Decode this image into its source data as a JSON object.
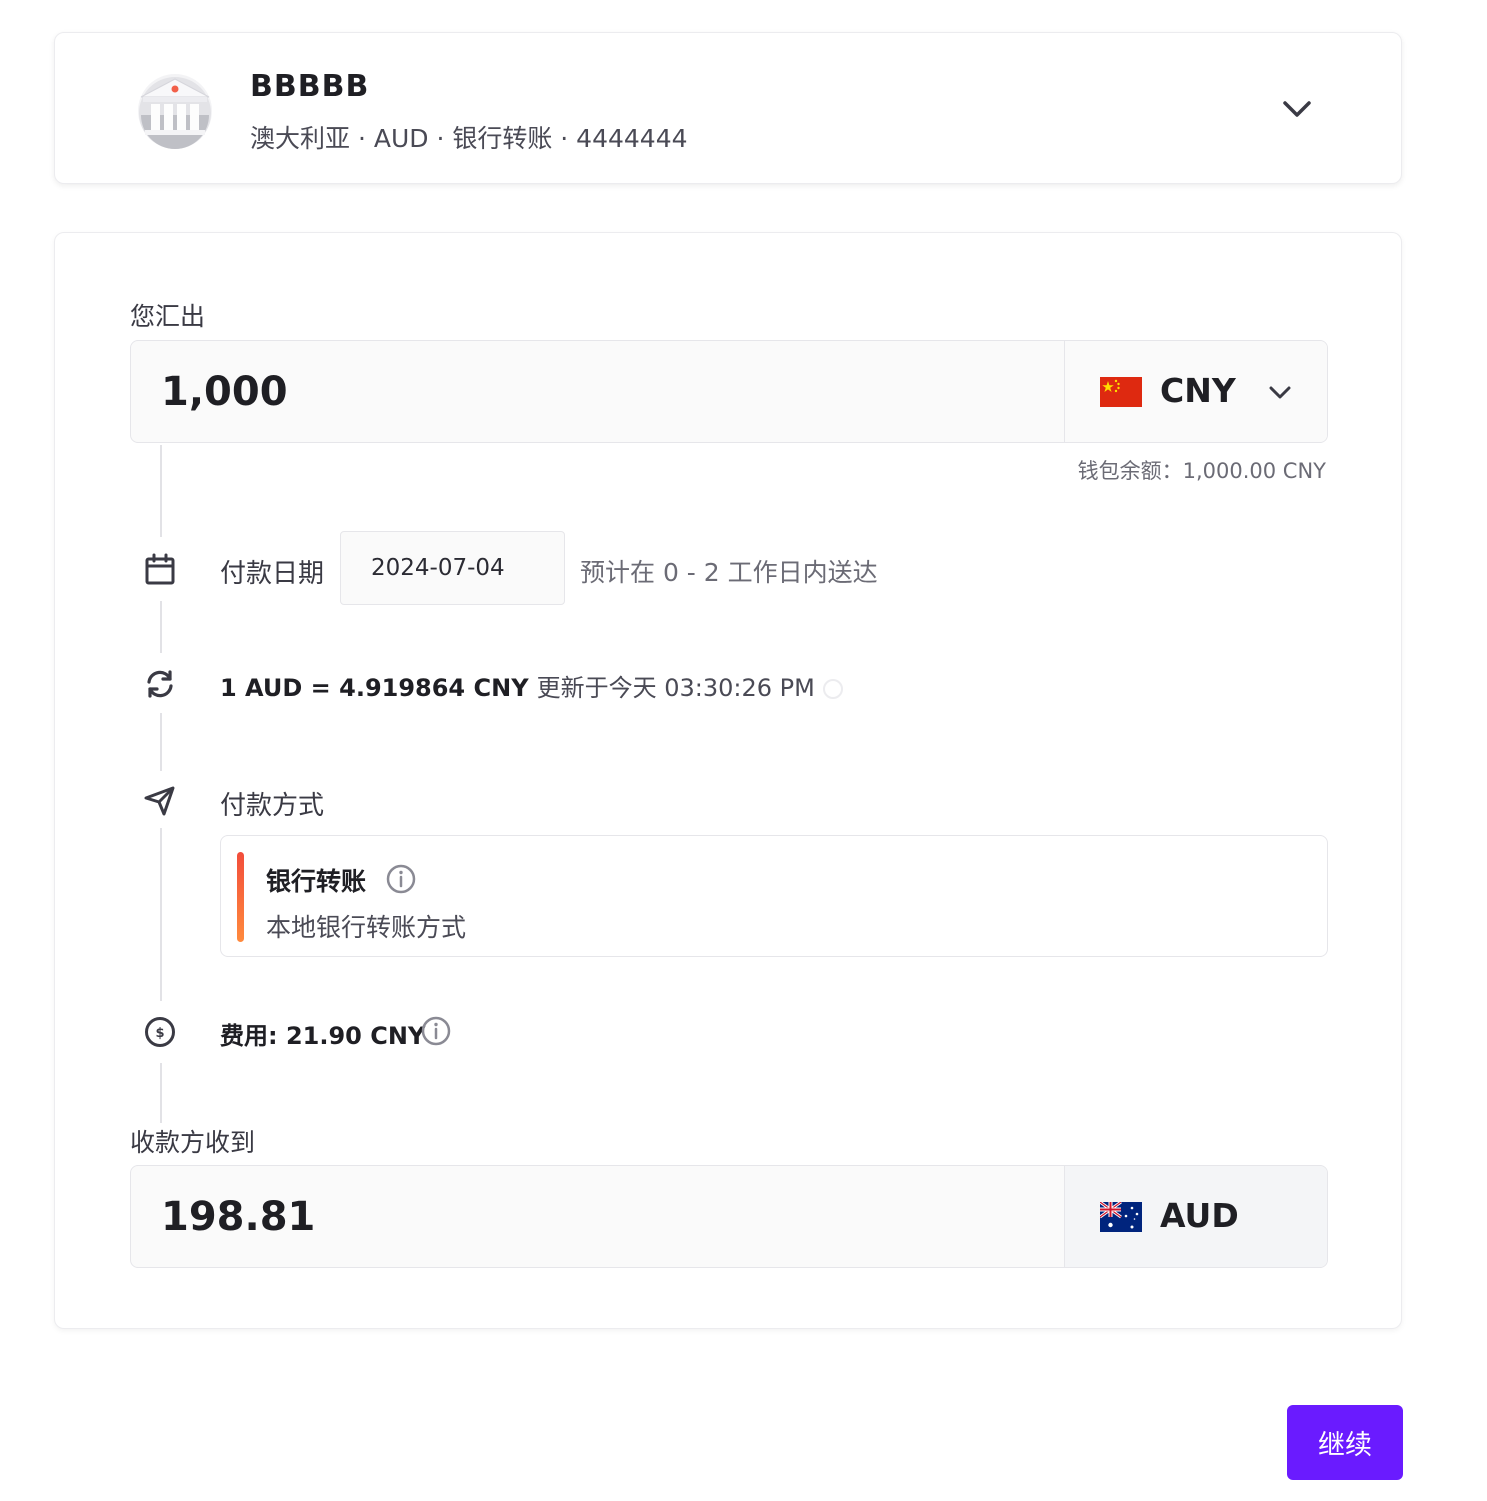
{
  "recipient": {
    "name": "BBBBB",
    "meta": "澳大利亚 · AUD · 银行转账 · 4444444",
    "avatar_icon": "bank-icon",
    "expand_icon": "chevron-down-icon"
  },
  "send": {
    "label": "您汇出",
    "amount": "1,000",
    "currency": "CNY",
    "flag_icon": "china-flag-icon",
    "balance": "钱包余额：1,000.00 CNY"
  },
  "payment_date": {
    "label": "付款日期",
    "value": "2024-07-04",
    "eta": "预计在 0 - 2 工作日内送达",
    "icon": "calendar-icon"
  },
  "rate": {
    "text": "1 AUD = 4.919864 CNY",
    "updated": "更新于今天 03:30:26 PM",
    "icon": "refresh-icon"
  },
  "method": {
    "label": "付款方式",
    "title": "银行转账",
    "subtitle": "本地银行转账方式",
    "icon": "send-plane-icon"
  },
  "fee": {
    "text": "费用: 21.90 CNY",
    "icon": "dollar-circle-icon"
  },
  "receive": {
    "label": "收款方收到",
    "amount": "198.81",
    "currency": "AUD",
    "flag_icon": "australia-flag-icon"
  },
  "actions": {
    "continue_label": "继续"
  },
  "colors": {
    "primary": "#6a1bff",
    "accent_bar_top": "#f24d3b",
    "accent_bar_bottom": "#ff8a3d"
  }
}
